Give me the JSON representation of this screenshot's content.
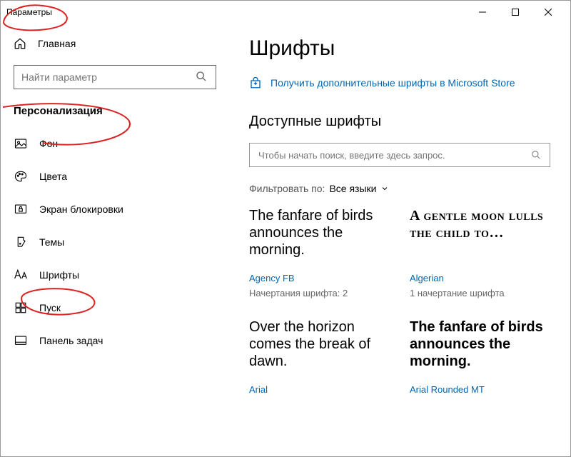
{
  "titlebar": {
    "title": "Параметры"
  },
  "sidebar": {
    "home": "Главная",
    "search_placeholder": "Найти параметр",
    "section": "Персонализация",
    "items": [
      {
        "label": "Фон"
      },
      {
        "label": "Цвета"
      },
      {
        "label": "Экран блокировки"
      },
      {
        "label": "Темы"
      },
      {
        "label": "Шрифты"
      },
      {
        "label": "Пуск"
      },
      {
        "label": "Панель задач"
      }
    ]
  },
  "main": {
    "title": "Шрифты",
    "store_link": "Получить дополнительные шрифты в Microsoft Store",
    "available": "Доступные шрифты",
    "font_search_placeholder": "Чтобы начать поиск, введите здесь запрос.",
    "filter_label": "Фильтровать по:",
    "filter_value": "Все языки",
    "fonts": [
      {
        "sample": "The fanfare of birds announces the morning.",
        "name": "Agency FB",
        "meta": "Начертания шрифта: 2"
      },
      {
        "sample": "A gentle moon lulls the child to…",
        "name": "Algerian",
        "meta": "1 начертание шрифта"
      },
      {
        "sample": "Over the horizon comes the break of dawn.",
        "name": "Arial",
        "meta": ""
      },
      {
        "sample": "The fanfare of birds announces the morning.",
        "name": "Arial Rounded MT",
        "meta": ""
      }
    ]
  }
}
